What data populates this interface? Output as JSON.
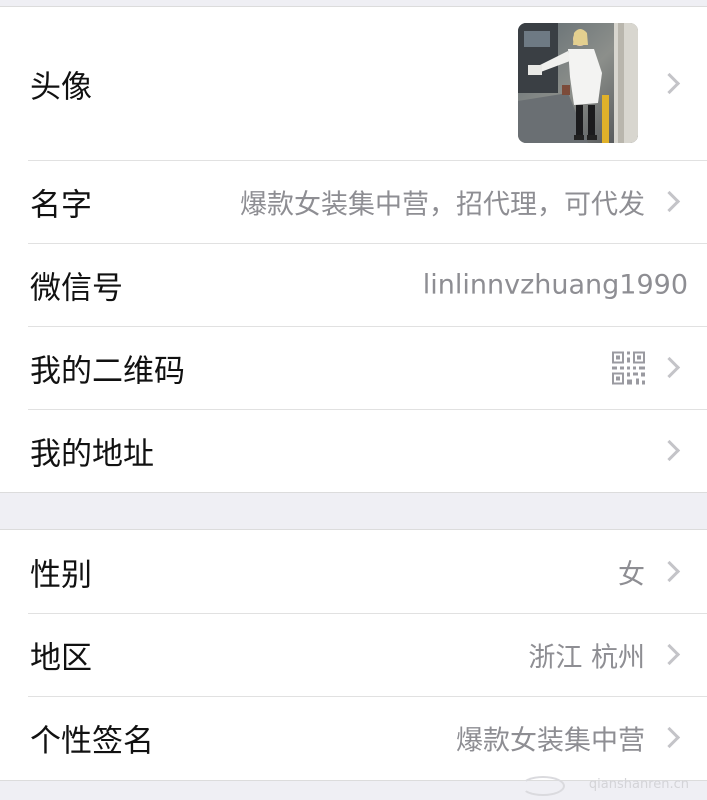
{
  "profile": {
    "avatar_label": "头像",
    "name_label": "名字",
    "name_value": "爆款女装集中营，招代理，可代发",
    "wechat_id_label": "微信号",
    "wechat_id_value": "linlinnvzhuang1990",
    "qr_label": "我的二维码",
    "address_label": "我的地址"
  },
  "details": {
    "gender_label": "性别",
    "gender_value": "女",
    "region_label": "地区",
    "region_value": "浙江 杭州",
    "signature_label": "个性签名",
    "signature_value": "爆款女装集中营"
  },
  "watermark": "qianshanren.cn",
  "icons": {
    "chevron": "chevron-right-icon",
    "qr": "qr-code-icon",
    "avatar": "avatar-image"
  },
  "colors": {
    "background": "#efeff4",
    "label": "#111111",
    "value": "#8e8e93",
    "chevron": "#c4c4c8"
  }
}
